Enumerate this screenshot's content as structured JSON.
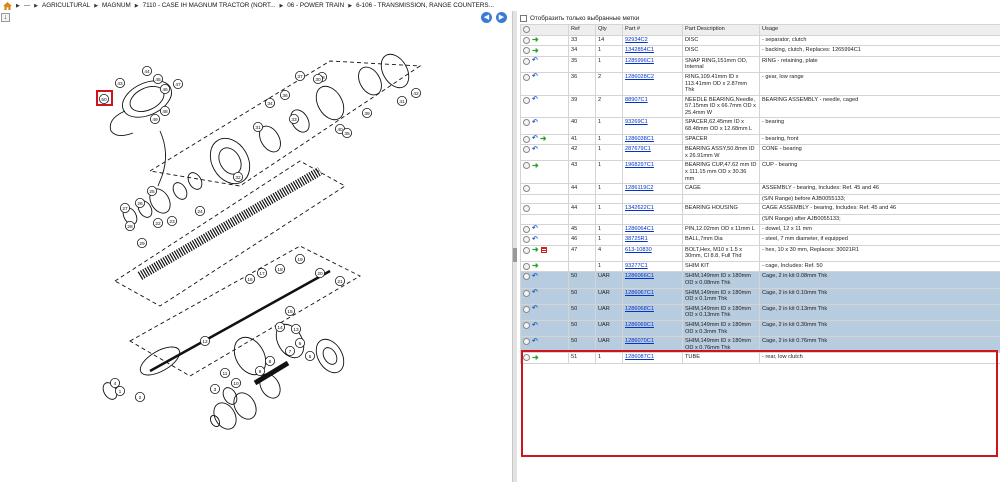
{
  "breadcrumb": {
    "ellipsis": "---",
    "items": [
      "AGRICULTURAL",
      "MAGNUM",
      "7110 - CASE IH MAGNUM TRACTOR (NORT...",
      "06 - POWER TRAIN",
      "6-106 - TRANSMISSION, RANGE COUNTERS..."
    ]
  },
  "viewer": {
    "highlighted_callout": "50",
    "callouts": [
      "43",
      "44",
      "45",
      "46",
      "47",
      "48",
      "49",
      "50",
      "39",
      "40",
      "41",
      "42",
      "37",
      "38",
      "36",
      "34",
      "35",
      "33",
      "30",
      "31",
      "32",
      "25",
      "26",
      "27",
      "28",
      "29",
      "22",
      "23",
      "24",
      "21",
      "20",
      "19",
      "18",
      "17",
      "16",
      "15",
      "14",
      "13",
      "12",
      "11",
      "10",
      "9",
      "8",
      "7",
      "6",
      "5",
      "4",
      "3",
      "2",
      "1"
    ]
  },
  "filter": {
    "label": "Отобразить только выбранные метки"
  },
  "table": {
    "columns": [
      "",
      "Ref",
      "Qty",
      "Part #",
      "Part Description",
      "Usage"
    ],
    "rows": [
      {
        "icons": [
          "circ",
          "go"
        ],
        "ref": "33",
        "qty": "14",
        "part": "92934C2",
        "desc": "DISC",
        "usage": "- separator, clutch",
        "sel": false
      },
      {
        "icons": [
          "circ",
          "go"
        ],
        "ref": "34",
        "qty": "1",
        "part": "1342854C1",
        "desc": "DISC",
        "usage": "- backing, clutch, Replaces: 1265994C1",
        "sel": false
      },
      {
        "icons": [
          "circ",
          "ret"
        ],
        "ref": "35",
        "qty": "1",
        "part": "1285996C1",
        "desc": "SNAP RING,151mm OD, Internal",
        "usage": "RING - retaining, plate",
        "sel": false
      },
      {
        "icons": [
          "circ",
          "ret"
        ],
        "ref": "36",
        "qty": "2",
        "part": "1286028C2",
        "desc": "RING,109.41mm ID x 113.41mm OD x 2.87mm Thk",
        "usage": "- gear, low range",
        "sel": false
      },
      {
        "icons": [
          "circ",
          "ret"
        ],
        "ref": "39",
        "qty": "2",
        "part": "88907C1",
        "desc": "NEEDLE BEARING,Needle, 57.15mm ID x 66.7mm OD x 25.4mm W",
        "usage": "BEARING ASSEMBLY - needle, caged",
        "sel": false
      },
      {
        "icons": [
          "circ",
          "ret"
        ],
        "ref": "40",
        "qty": "1",
        "part": "93269C1",
        "desc": "SPACER,62.45mm ID x 68.48mm OD x 12.68mm L",
        "usage": "- bearing",
        "sel": false
      },
      {
        "icons": [
          "circ",
          "ret",
          "go"
        ],
        "ref": "41",
        "qty": "1",
        "part": "1286038C1",
        "desc": "SPACER",
        "usage": "- bearing, front",
        "sel": false
      },
      {
        "icons": [
          "circ",
          "ret"
        ],
        "ref": "42",
        "qty": "1",
        "part": "287679C1",
        "desc": "BEARING ASSY,50.8mm ID x 26.91mm W",
        "usage": "CONE - bearing",
        "sel": false
      },
      {
        "icons": [
          "circ",
          "go"
        ],
        "ref": "43",
        "qty": "1",
        "part": "1968297C1",
        "desc": "BEARING CUP,47.62 mm ID x 111.15 mm OD x 30.36 mm",
        "usage": "CUP - bearing",
        "sel": false
      },
      {
        "icons": [
          "circ"
        ],
        "ref": "44",
        "qty": "1",
        "part": "1286119C2",
        "desc": "CAGE",
        "usage": "ASSEMBLY - bearing, Includes: Ref. 45 and 46",
        "sel": false
      },
      {
        "icons": [],
        "ref": "",
        "qty": "",
        "part": "",
        "desc": "",
        "usage": "(S/N Range) before AJB0055133;",
        "sel": false
      },
      {
        "icons": [
          "circ"
        ],
        "ref": "44",
        "qty": "1",
        "part": "1342622C1",
        "desc": "BEARING HOUSING",
        "usage": "CAGE ASSEMBLY - bearing, Includes: Ref. 45 and 46",
        "sel": false
      },
      {
        "icons": [],
        "ref": "",
        "qty": "",
        "part": "",
        "desc": "",
        "usage": "(S/N Range) after AJB0055133;",
        "sel": false
      },
      {
        "icons": [
          "circ",
          "ret"
        ],
        "ref": "45",
        "qty": "1",
        "part": "1286064C1",
        "desc": "PIN,12.02mm OD x 11mm L",
        "usage": "- dowel, 12 x 11 mm",
        "sel": false
      },
      {
        "icons": [
          "circ",
          "ret"
        ],
        "ref": "46",
        "qty": "1",
        "part": "38725R1",
        "desc": "BALL,7mm Dia",
        "usage": "- steel, 7 mm diameter, if equipped",
        "sel": false
      },
      {
        "icons": [
          "circ",
          "go",
          "doc"
        ],
        "ref": "47",
        "qty": "4",
        "part": "613-10830",
        "desc": "BOLT,Hex, M10 x 1.5 x 30mm, Cl 8.8, Full Thd",
        "usage": "- hex, 10 x 30 mm, Replaces: 30021R1",
        "sel": false
      },
      {
        "icons": [
          "circ",
          "go"
        ],
        "ref": "",
        "qty": "1",
        "part": "93277C1",
        "desc": "SHIM KIT",
        "usage": "- cage, Includes: Ref. 50",
        "sel": false
      },
      {
        "icons": [
          "circ",
          "ret"
        ],
        "ref": "50",
        "qty": "UAR",
        "part": "1286066C1",
        "desc": "SHIM,149mm ID x 180mm OD x 0.08mm Thk",
        "usage": "Cage, 2 in kit 0.08mm Thk",
        "sel": true
      },
      {
        "icons": [
          "circ",
          "ret"
        ],
        "ref": "50",
        "qty": "UAR",
        "part": "1286067C1",
        "desc": "SHIM,149mm ID x 180mm OD x 0.1mm Thk",
        "usage": "Cage, 2 in kit 0.10mm Thk",
        "sel": true
      },
      {
        "icons": [
          "circ",
          "ret"
        ],
        "ref": "50",
        "qty": "UAR",
        "part": "1286068C1",
        "desc": "SHIM,149mm ID x 180mm OD x 0.13mm Thk",
        "usage": "Cage, 2 in kit 0.13mm Thk",
        "sel": true
      },
      {
        "icons": [
          "circ",
          "ret"
        ],
        "ref": "50",
        "qty": "UAR",
        "part": "1286069C1",
        "desc": "SHIM,149mm ID x 180mm OD x 0.3mm Thk",
        "usage": "Cage, 2 in kit 0.30mm Thk",
        "sel": true
      },
      {
        "icons": [
          "circ",
          "ret"
        ],
        "ref": "50",
        "qty": "UAR",
        "part": "1286070C1",
        "desc": "SHIM,149mm ID x 180mm OD x 0.76mm Thk",
        "usage": "Cage, 2 in kit 0.76mm Thk",
        "sel": true
      },
      {
        "icons": [
          "circ",
          "go"
        ],
        "ref": "51",
        "qty": "1",
        "part": "1286087C1",
        "desc": "TUBE",
        "usage": "- rear, low clutch",
        "sel": false
      }
    ]
  },
  "colors": {
    "selected_row": "#b7ccdf",
    "highlight_border": "#d0141c",
    "link": "#0033cc",
    "nav_button": "#3a7bd5"
  }
}
